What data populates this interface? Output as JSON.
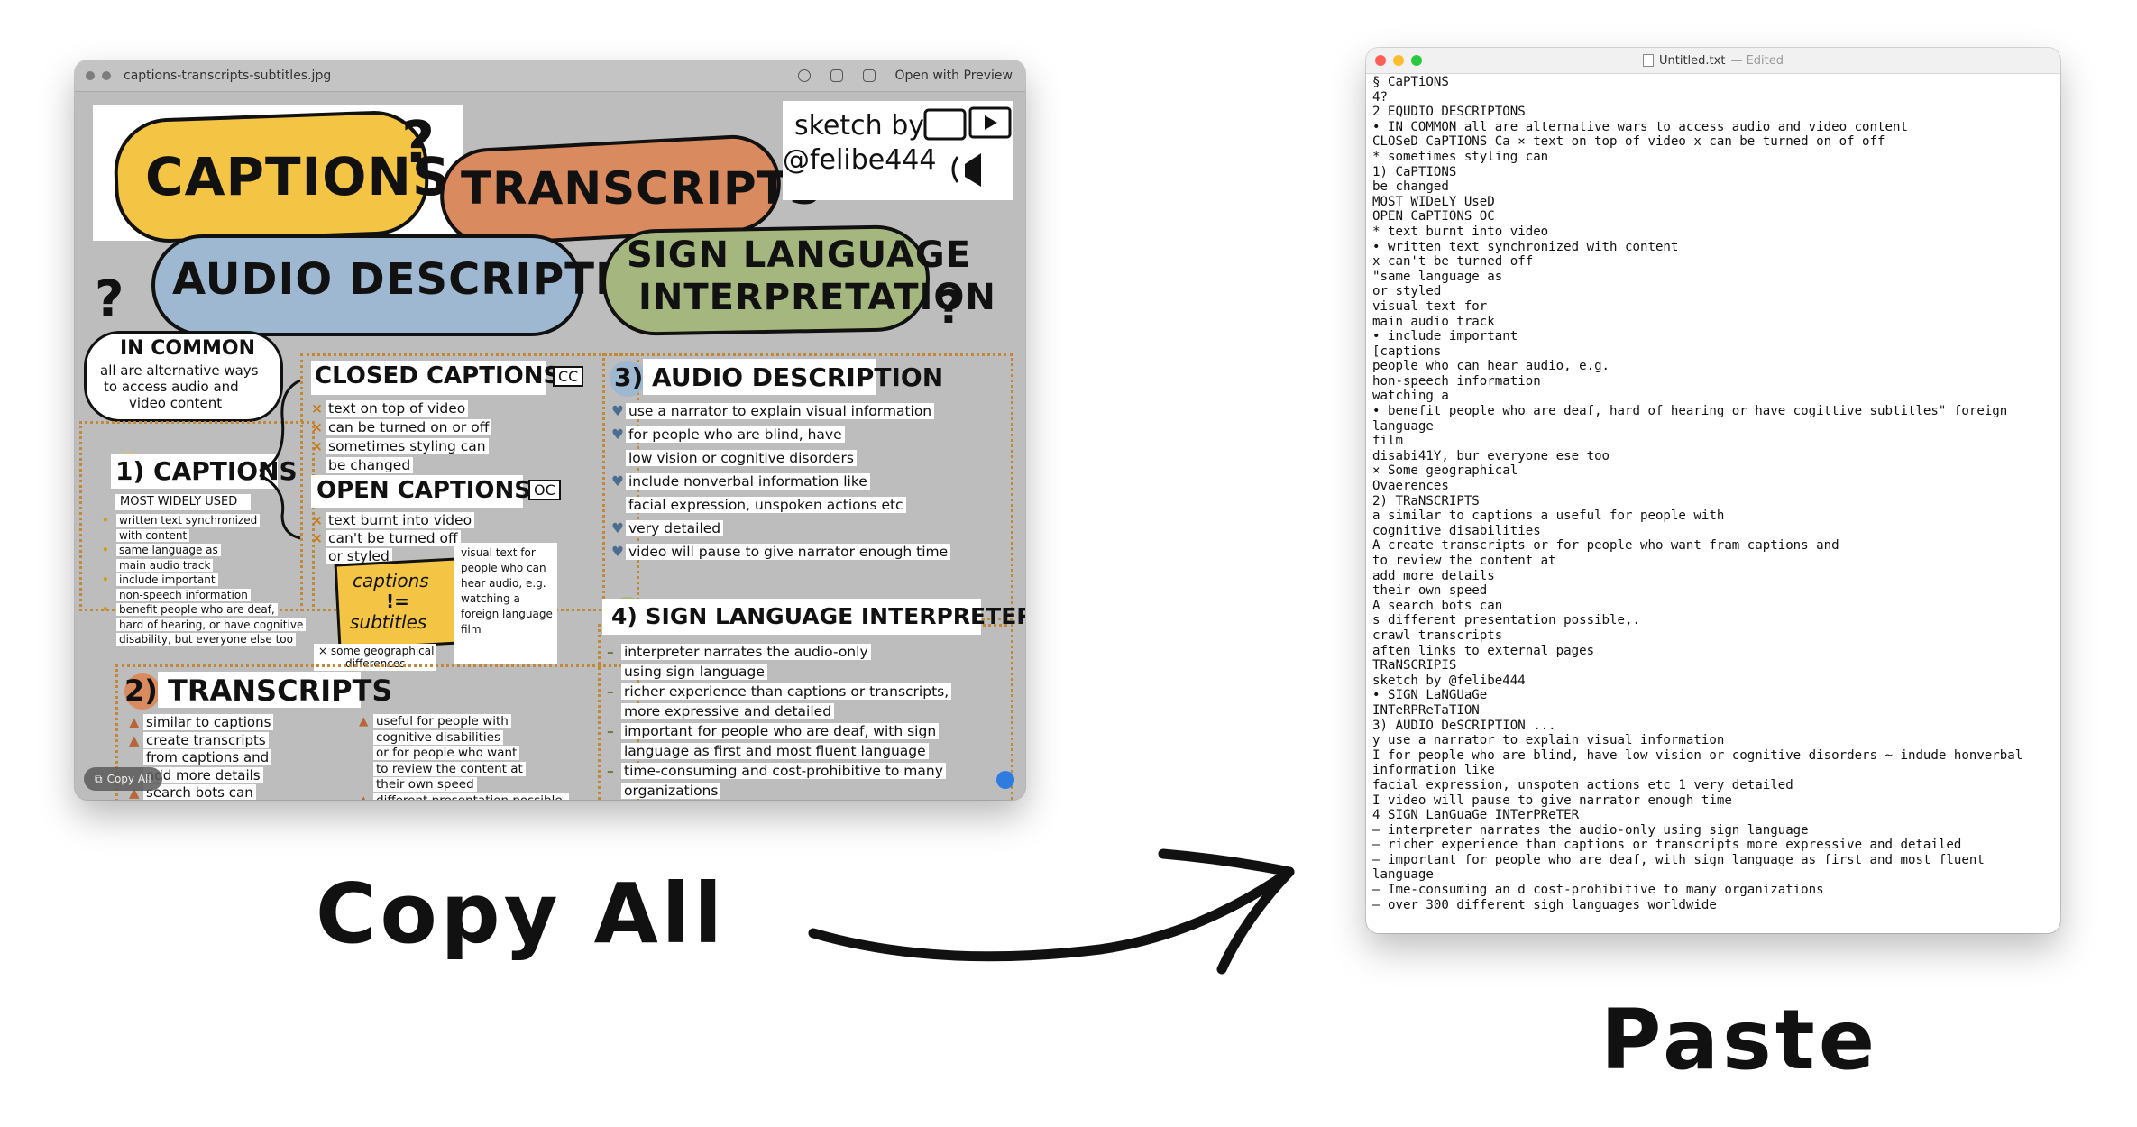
{
  "preview": {
    "title": "captions-transcripts-subtitles.jpg",
    "open_with": "Open with Preview",
    "copy_all_pill": "Copy All",
    "sketch": {
      "h_captions": "CAPTIONS",
      "h_transcripts": "TRANSCRIPTS",
      "h_audio": "AUDIO DESCRIPTIONS",
      "h_sign1": "SIGN LANGUAGE",
      "h_sign2": "INTERPRETATION",
      "q": "?",
      "sketch_by1": "sketch by",
      "sketch_by2": "@felibe444",
      "in_common": "IN COMMON",
      "in_common_1": "all are alternative ways",
      "in_common_2": "to access audio and",
      "in_common_3": "video content",
      "closed_captions": "CLOSED CAPTIONS",
      "cc": "CC",
      "closed_items": [
        "text on top of video",
        "can be turned on or off",
        "sometimes styling can",
        "be changed"
      ],
      "open_captions": "OPEN CAPTIONS",
      "oc": "OC",
      "open_items": [
        "text burnt into video",
        "can't be turned off",
        "or styled"
      ],
      "captions_num": "1) CAPTIONS",
      "most_widely": "MOST WIDELY USED",
      "captions_items": [
        "written text synchronized",
        "with content",
        "same language as",
        "main audio track",
        "include important",
        "non-speech information",
        "benefit people who are deaf,",
        "hard of hearing, or have cognitive",
        "disability, but everyone else too"
      ],
      "captions_ne_1": "captions",
      "captions_ne_2": "!=",
      "captions_ne_3": "subtitles",
      "subtitles_note": [
        "visual text for",
        "people who can",
        "hear audio, e.g.",
        "watching a",
        "foreign language",
        "film"
      ],
      "geo_note_1": "× some geographical",
      "geo_note_2": "differences",
      "transcripts_num": "2) TRANSCRIPTS",
      "trans_left": [
        "similar to captions",
        "create transcripts",
        "from captions and",
        "add more details",
        "search bots can",
        "crawl transcripts"
      ],
      "trans_right": [
        "useful for people with",
        "cognitive disabilities",
        "or for people who want",
        "to review the content at",
        "their own speed",
        "different presentation possible,",
        "after links to external pages"
      ],
      "audio_num": "3) AUDIO DESCRIPTION",
      "audio_items": [
        "use a narrator to explain visual information",
        "for people who are blind, have",
        "low vision or cognitive disorders",
        "include nonverbal information like",
        "facial expression, unspoken actions etc",
        "very detailed",
        "video will pause to give narrator enough time"
      ],
      "sign_num": "4) SIGN LANGUAGE INTERPRETER",
      "sign_items": [
        "interpreter narrates the audio-only",
        "using sign language",
        "richer experience than captions or transcripts,",
        "more expressive and detailed",
        "important for people who are deaf, with sign",
        "language as first and most fluent language",
        "time-consuming and cost-prohibitive to many",
        "organizations",
        "over 300 different sign languages worldwide"
      ]
    }
  },
  "labels": {
    "copy_all": "Copy All",
    "paste": "Paste"
  },
  "editor": {
    "title": "Untitled.txt",
    "status": "— Edited",
    "lines": [
      "§ CaPTiONS",
      "4?",
      "2 EQUDIO DESCRIPTONS",
      "• IN COMMON all are alternative wars to access audio and video content",
      "CLOSeD CaPTIONS Ca × text on top of video x can be turned on of off",
      "* sometimes styling can",
      "1) CaPTIONS",
      "be changed",
      "MOST WIDeLY UseD",
      "OPEN CaPTIONS OC",
      "* text burnt into video",
      "• written text synchronized with content",
      "x can't be turned off",
      "\"same language as",
      "or styled",
      "visual text for",
      "main audio track",
      "• include important",
      "[captions",
      "people who can hear audio, e.g.",
      "hon-speech information",
      "watching a",
      "• benefit people who are deaf, hard of hearing or have cogittive subtitles\" foreign",
      "language",
      "film",
      "disabi41Y, bur everyone ese too",
      "× Some geographical",
      "Ovaerences",
      "2) TRaNSCRIPTS",
      "a similar to captions a useful for people with",
      "cognitive disabilities",
      "A create transcripts or for people who want fram captions and",
      "to review the content at",
      "add more details",
      "their own speed",
      "A search bots can",
      "s different presentation possible,.",
      "crawl transcripts",
      "aften links to external pages",
      "TRaNSCRIPIS",
      "sketch by @felibe444",
      "• SIGN LaNGUaGe",
      "INTeRPReTaTION",
      "3) AUDIO DeSCRIPTION ...",
      "y use a narrator to explain visual information",
      "I for people who are blind, have low vision or cognitive disorders ~ indude honverbal",
      "information like",
      "facial expression, unspoten actions etc 1 very detailed",
      "I video will pause to give narrator enough time",
      "4 SIGN LanGuaGe INTerPReTER",
      "– interpreter narrates the audio-only using sign language",
      "– richer experience than captions or transcripts more expressive and detailed",
      "– important for people who are deaf, with sign language as first and most fluent",
      "language",
      "– Ime-consuming an d cost-prohibitive to many organizations",
      "– over 300 different sigh languages worldwide"
    ]
  }
}
